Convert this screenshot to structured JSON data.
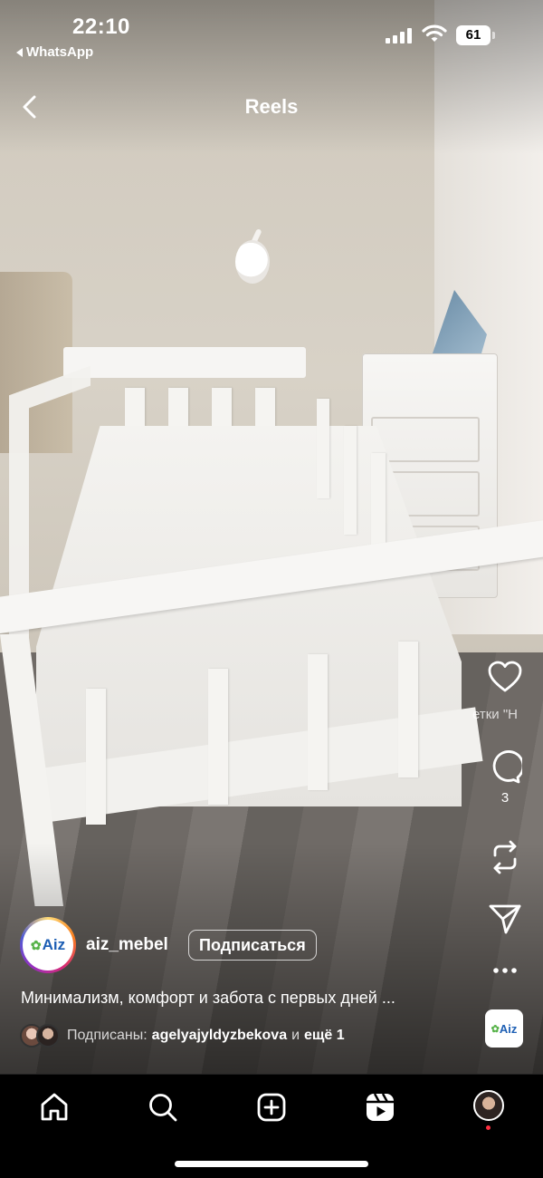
{
  "status_bar": {
    "time": "22:10",
    "back_app": "WhatsApp",
    "battery": "61"
  },
  "header": {
    "title": "Reels"
  },
  "actions": {
    "comments_count": "3",
    "overlay_text": "етки \"Н"
  },
  "post": {
    "avatar_text": "Aiz",
    "username": "aiz_mebel",
    "follow_label": "Подписаться",
    "caption": "Минимализм, комфорт и забота с первых дней ...",
    "followers_label": "Подписаны:",
    "followers_name": "agelyajyldyzbekova",
    "followers_and": "и",
    "followers_more": "ещё 1",
    "audio_thumb_text": "Aiz"
  },
  "tabbar": {
    "tabs": [
      "home-icon",
      "search-icon",
      "create-icon",
      "reels-icon",
      "profile-avatar"
    ]
  },
  "colors": {
    "background": "#000000",
    "notification_dot": "#ff3040",
    "text": "#ffffff"
  }
}
